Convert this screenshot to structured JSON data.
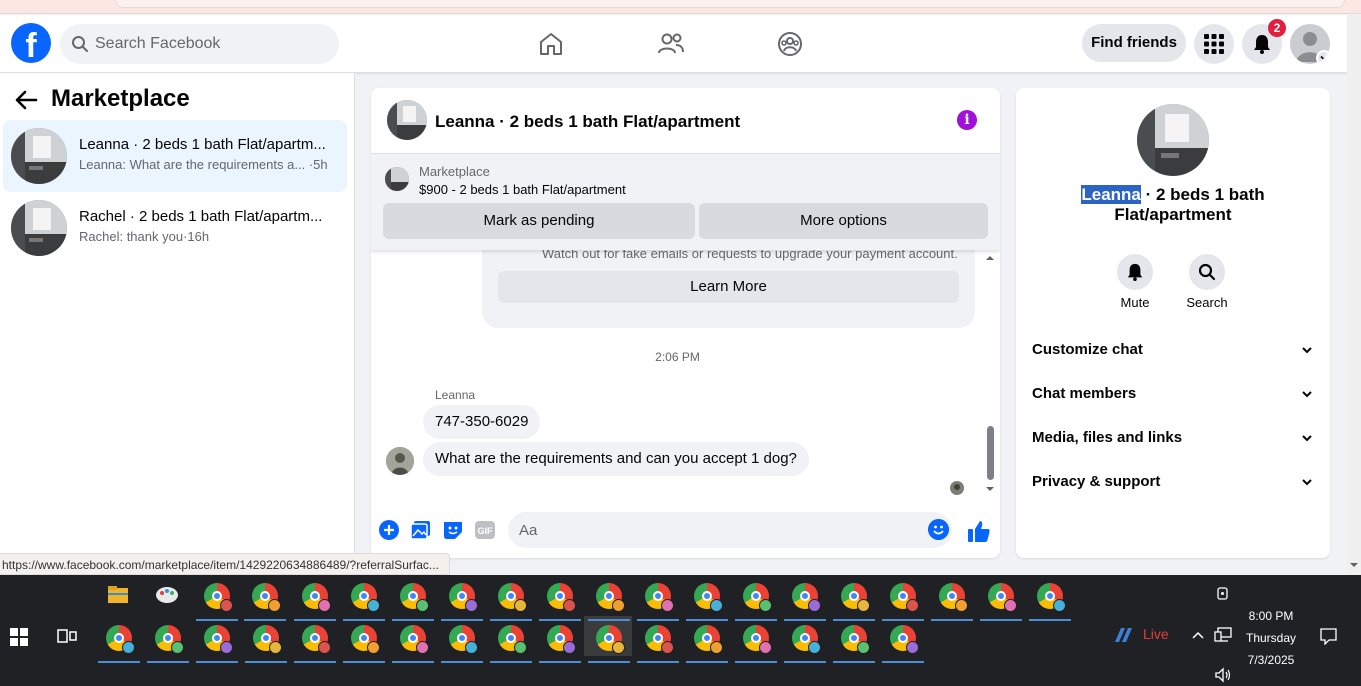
{
  "topnav": {
    "logo": "f",
    "search_placeholder": "Search Facebook",
    "find_friends_label": "Find friends",
    "notification_count": "2"
  },
  "sidebar": {
    "title": "Marketplace",
    "conversations": [
      {
        "name": "Leanna · 2 beds 1 bath Flat/apartm...",
        "preview": "Leanna: What are the requirements a...",
        "time": "·5h"
      },
      {
        "name": "Rachel · 2 beds 1 bath Flat/apartm...",
        "preview": "Rachel: thank you",
        "time": "·16h"
      }
    ]
  },
  "chat": {
    "title": "Leanna · 2 beds 1 bath Flat/apartment",
    "listing": {
      "source": "Marketplace",
      "price_title": "$900 - 2 beds 1 bath Flat/apartment",
      "mark_pending_label": "Mark as pending",
      "more_options_label": "More options"
    },
    "safety_text": "Watch out for fake emails or requests to upgrade your payment account.",
    "learn_more_label": "Learn More",
    "timestamp": "2:06 PM",
    "sender": "Leanna",
    "messages": [
      "747-350-6029",
      "What are the requirements and can you accept 1 dog?"
    ],
    "composer_placeholder": "Aa"
  },
  "right_panel": {
    "title_highlight": "Leanna",
    "title_rest": " · 2 beds 1 bath Flat/apartment",
    "actions": [
      {
        "label": "Mute"
      },
      {
        "label": "Search"
      }
    ],
    "sections": [
      "Customize chat",
      "Chat members",
      "Media, files and links",
      "Privacy & support"
    ]
  },
  "status_url": "https://www.facebook.com/marketplace/item/1429220634886489/?referralSurfac...",
  "taskbar": {
    "live_label": "Live",
    "time": "8:00 PM",
    "day": "Thursday",
    "date": "7/3/2025"
  },
  "colors": {
    "brand": "#0866ff",
    "badge": "#e41e3f",
    "info": "#a010d8",
    "selected_row": "#ebf5ff"
  }
}
